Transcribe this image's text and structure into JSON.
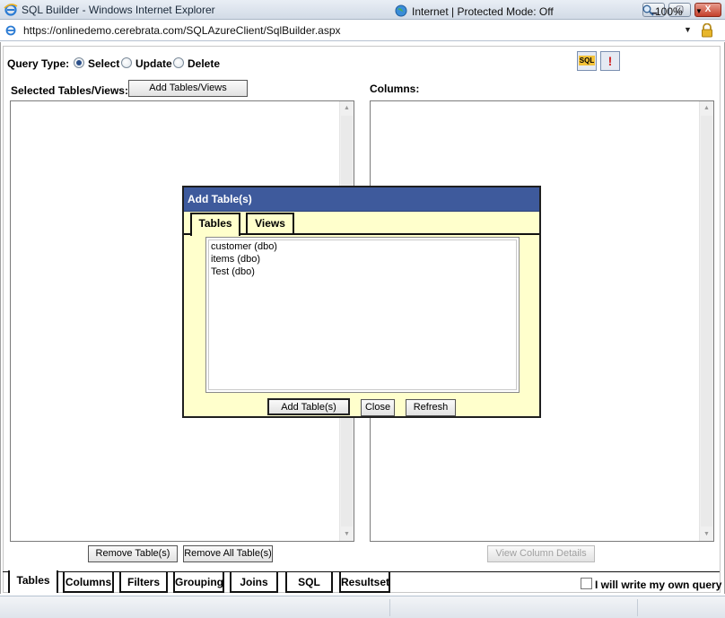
{
  "window": {
    "title": "SQL Builder - Windows Internet Explorer",
    "minimize": "▁",
    "maximize": "▢",
    "close": "X"
  },
  "address": {
    "url": "https://onlinedemo.cerebrata.com/SQLAzureClient/SqlBuilder.aspx"
  },
  "query": {
    "label": "Query Type:",
    "options": [
      "Select",
      "Update",
      "Delete"
    ],
    "selected": "Select"
  },
  "toolbar": {
    "sql_icon_label": "SQL",
    "execute_icon_label": "!"
  },
  "left_panel": {
    "label": "Selected Tables/Views:",
    "add_button": "Add Tables/Views",
    "remove_button": "Remove Table(s)",
    "remove_all_button": "Remove All Table(s)"
  },
  "right_panel": {
    "label": "Columns:",
    "details_button": "View Column Details"
  },
  "dialog": {
    "title": "Add Table(s)",
    "tabs": [
      "Tables",
      "Views"
    ],
    "active_tab": "Tables",
    "items": [
      "customer (dbo)",
      "items (dbo)",
      "Test (dbo)"
    ],
    "add_button": "Add Table(s)",
    "close_button": "Close",
    "refresh_button": "Refresh"
  },
  "bottom_tabs": [
    "Tables",
    "Columns",
    "Filters",
    "Grouping",
    "Joins",
    "SQL",
    "Resultset"
  ],
  "active_bottom_tab": "Tables",
  "own_query": {
    "label": "I will write my own query",
    "checked": false
  },
  "status": {
    "zone": "Internet | Protected Mode: Off",
    "zoom": "100%"
  },
  "colors": {
    "dialog_title_bg": "#3e5a9c",
    "dialog_bg": "#ffffcc"
  }
}
